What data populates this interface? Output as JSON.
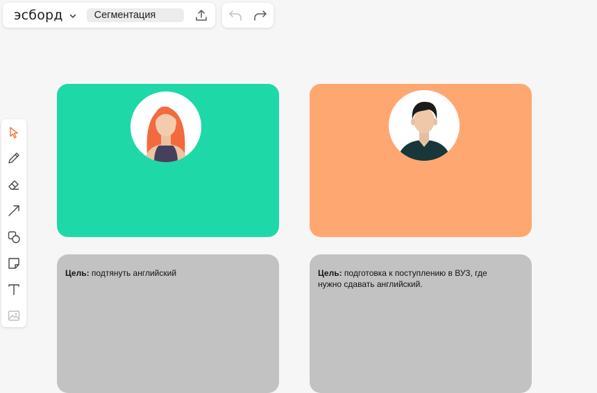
{
  "app": {
    "logo": "эсборд",
    "board_name": "Сегментация"
  },
  "icons": {
    "export": "upload-icon",
    "undo": "undo-icon",
    "redo": "redo-icon"
  },
  "toolbar": {
    "tools": [
      "select-cursor-icon",
      "pencil-icon",
      "eraser-icon",
      "arrow-line-icon",
      "shapes-icon",
      "sticky-note-icon",
      "text-icon",
      "image-icon"
    ],
    "active_color": "#f07a3e"
  },
  "cards": [
    {
      "color": "#1fd8a8",
      "avatar": "female-avatar"
    },
    {
      "color": "#ffa771",
      "avatar": "male-avatar"
    }
  ],
  "goals": [
    {
      "label": "Цель:",
      "text": " подтянуть английский"
    },
    {
      "label": "Цель:",
      "text": " подготовка к поступлению в ВУЗ, где нужно сдавать английский."
    }
  ]
}
